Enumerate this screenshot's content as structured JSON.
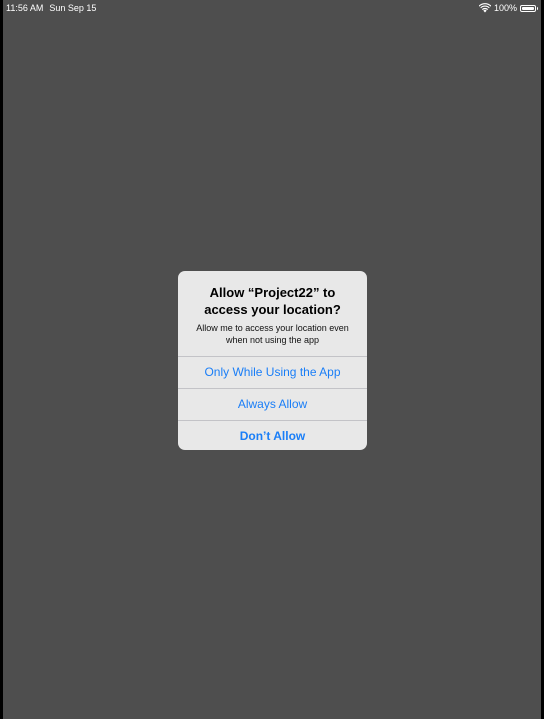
{
  "status_bar": {
    "time": "11:56 AM",
    "date": "Sun Sep 15",
    "battery_percent": "100%",
    "battery_level": 1.0
  },
  "alert": {
    "title": "Allow “Project22” to access your location?",
    "message": "Allow me to access your location even when not using the app",
    "buttons": [
      {
        "label": "Only While Using the App"
      },
      {
        "label": "Always Allow"
      },
      {
        "label": "Don’t Allow"
      }
    ],
    "button_color": "#1a7ef7"
  },
  "colors": {
    "dimmed_background": "#4e4e4e",
    "alert_background": "#e8e8e8"
  }
}
